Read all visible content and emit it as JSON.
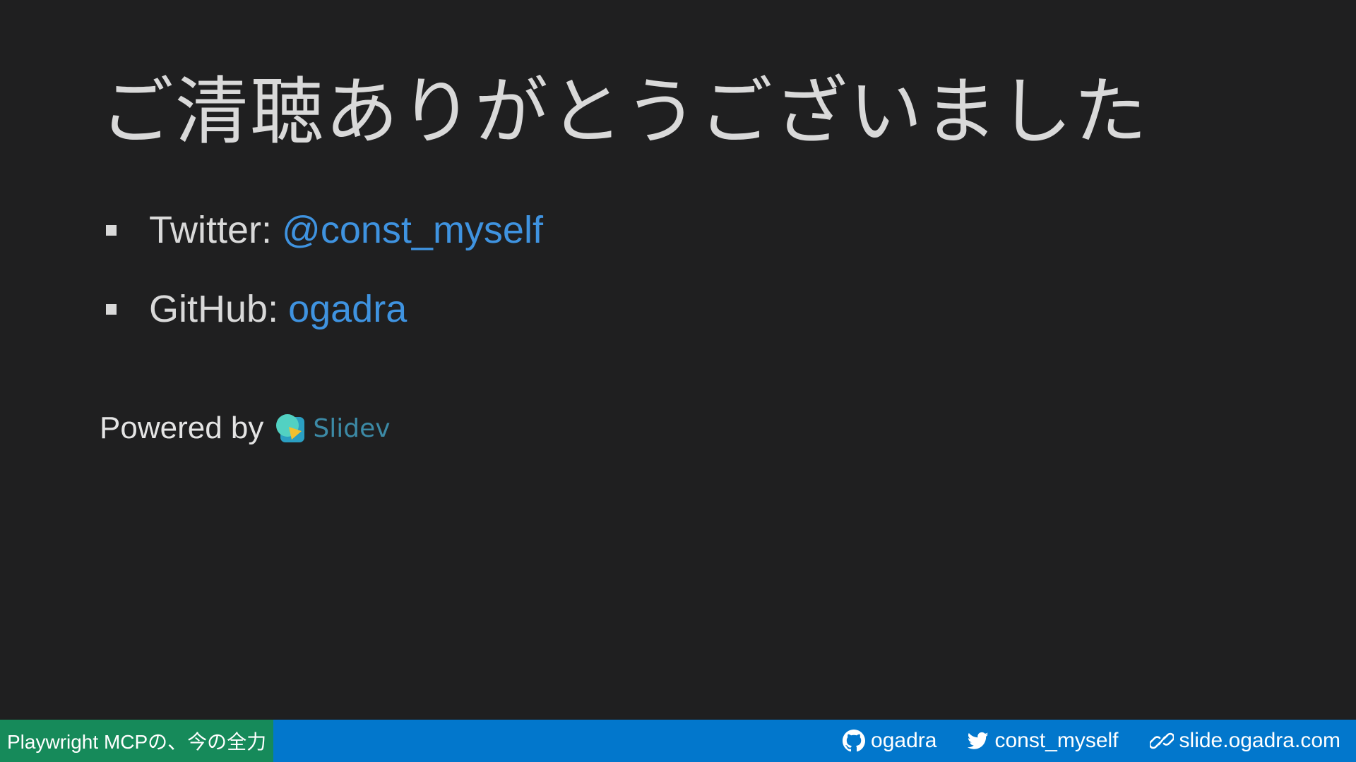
{
  "slide": {
    "title": "ご清聴ありがとうございました",
    "items": [
      {
        "label": "Twitter:",
        "link_text": "@const_myself"
      },
      {
        "label": "GitHub:",
        "link_text": "ogadra"
      }
    ],
    "powered_by": {
      "text": "Powered by",
      "brand": "Slidev",
      "logo_icon": "slidev-logo-icon"
    }
  },
  "footer": {
    "title": "Playwright MCPの、今の全力",
    "links": [
      {
        "icon": "github-icon",
        "text": "ogadra"
      },
      {
        "icon": "twitter-icon",
        "text": "const_myself"
      },
      {
        "icon": "link-icon",
        "text": "slide.ogadra.com"
      }
    ]
  },
  "colors": {
    "background": "#1f1f20",
    "text": "#d9d9d9",
    "link": "#3f93e0",
    "footer_bar": "#0277cc",
    "footer_title_bg": "#168a5a"
  }
}
